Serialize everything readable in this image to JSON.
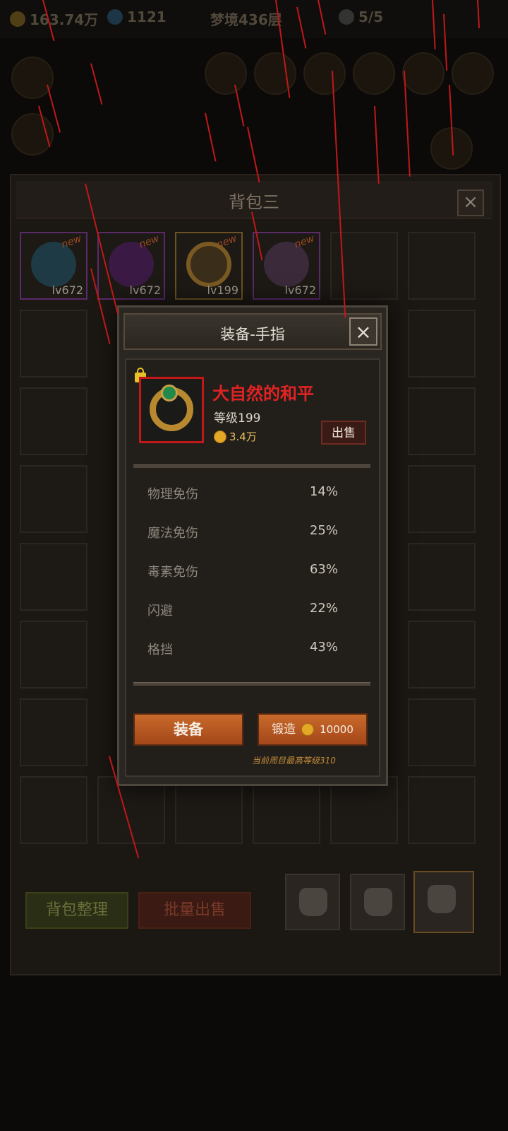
{
  "topbar": {
    "gold": "163.74万",
    "gems": "1121",
    "stage": "梦境436层",
    "skulls": "5/5"
  },
  "bag": {
    "title": "背包三",
    "items": [
      {
        "level": "lv672",
        "new": "new"
      },
      {
        "level": "lv672",
        "new": "new"
      },
      {
        "level": "lv199",
        "new": "new"
      },
      {
        "level": "lv672",
        "new": "new"
      }
    ],
    "sort_label": "背包整理",
    "batch_sell_label": "批量出售"
  },
  "modal": {
    "title": "装备-手指",
    "item_name": "大自然的和平",
    "item_level": "等级199",
    "price": "3.4万",
    "sell_label": "出售",
    "stats": [
      {
        "name": "物理免伤",
        "value": "14%"
      },
      {
        "name": "魔法免伤",
        "value": "25%"
      },
      {
        "name": "毒素免伤",
        "value": "63%"
      },
      {
        "name": "闪避",
        "value": "22%"
      },
      {
        "name": "格挡",
        "value": "43%"
      }
    ],
    "equip_label": "装备",
    "forge_label": "锻造",
    "forge_cost": "10000",
    "note": "当前周目最高等级310"
  },
  "colors": {
    "accent": "#c86a2a",
    "name_red": "#e02323",
    "gold": "#e3a826"
  }
}
